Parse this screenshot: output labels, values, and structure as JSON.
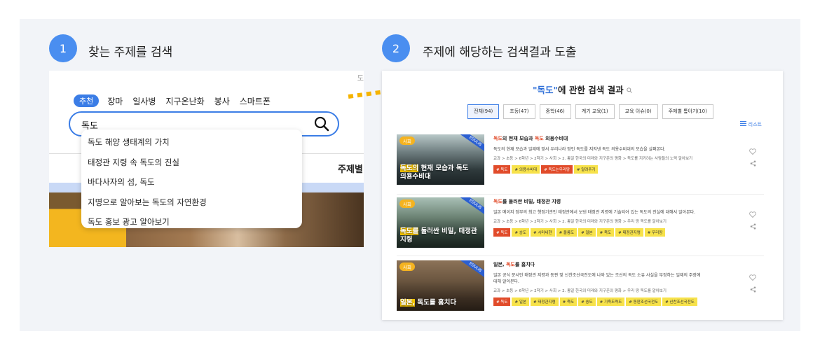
{
  "step1": {
    "number": "1",
    "title": "찾는 주제를 검색"
  },
  "step2": {
    "number": "2",
    "title": "주제에 해당하는 검색결과 도출"
  },
  "panel1": {
    "corner_text": "도",
    "tabs": [
      "추천",
      "장마",
      "일사병",
      "지구온난화",
      "봉사",
      "스마트폰"
    ],
    "search_value": "독도",
    "suggestions": [
      "독도 해양 생태계의 가치",
      "태정관 지령 속 독도의 진실",
      "바다사자의 섬, 독도",
      "지명으로 알아보는 독도의 자연환경",
      "독도 홍보 광고 알아보기"
    ],
    "side_label": "주제별"
  },
  "panel2": {
    "title_prefix": "\"독도\"",
    "title_suffix": "에 관한 검색 결과",
    "chips": [
      "전체(94)",
      "초등(47)",
      "중학(46)",
      "계기 교육(1)",
      "교육 이슈(0)",
      "주제별 톺아기(10)"
    ],
    "list_view_label": "리스트",
    "items": [
      {
        "category": "사회",
        "ribbon": "EDULIB",
        "thumb_hl": "독도의",
        "thumb_rest": " 현재 모습과 독도",
        "thumb_line2": "의용수비대",
        "title_a": "독도",
        "title_b": "의 현재 모습과 ",
        "title_c": "독도",
        "title_d": " 의용수비대",
        "desc": "독도의 현재 모습과 일제에 맞서 우리나라 땅인 독도를 지켜낸 독도 의용수비대의 모습을 살펴본다.",
        "path": "교과 > 초등 > 6학년 > 2학기 > 사회 > 2. 통일 한국의 미래와 지구촌의 평화 > 독도를 지키려는 사람들의 노력 알아보기",
        "tags": [
          "# 독도",
          "# 의용수비대",
          "# 독도는우리땅",
          "# 알려주기"
        ]
      },
      {
        "category": "사회",
        "ribbon": "EDULIB",
        "thumb_hl": "독도를",
        "thumb_rest": " 둘러싼 비밀, 태정관",
        "thumb_line2": "지령",
        "title_a": "독도",
        "title_b": "를 둘러싼 비밀, 태정관 지령",
        "title_c": "",
        "title_d": "",
        "desc": "일본 메이지 정부의 최고 행정기관인 태정관에서 보낸 태정관 지령에 기술되어 있는 독도의 진실에 대해서 알아본다.",
        "path": "교과 > 초등 > 6학년 > 2학기 > 사회 > 2. 통일 한국의 미래와 지구촌의 평화 > 우리 땅 독도를 알아보기",
        "tags": [
          "# 독도",
          "# 송도",
          "# 시마네현",
          "# 울릉도",
          "# 일본",
          "# 죽도",
          "# 태정관지령",
          "# 우리땅"
        ]
      },
      {
        "category": "사회",
        "ribbon": "EDULIB",
        "thumb_hl": "일본,",
        "thumb_rest": " 독도를 훔치다",
        "thumb_line2": "",
        "title_a": "",
        "title_b": "일본, ",
        "title_c": "독도",
        "title_d": "를 훔치다",
        "desc": "일본 공식 문서인 태정관 지령과 동판 및 신찬조선국전도에 나와 있는 조선의 독도 소유 사실을 부정하는 일제의 주장에 대해 알아본다.",
        "path": "교과 > 초등 > 6학년 > 2학기 > 사회 > 2. 통일 한국의 미래와 지구촌의 평화 > 우리 땅 독도를 알아보기",
        "tags": [
          "# 독도",
          "# 일본",
          "# 태정관지령",
          "# 죽도",
          "# 송도",
          "# 기죽도략도",
          "# 동판조선국전도",
          "# 신찬조선국전도"
        ]
      }
    ]
  },
  "colors": {
    "accent": "#3b7de6",
    "highlight": "#e14b2a",
    "tag": "#f7e24a",
    "arrow": "#f5b300"
  }
}
